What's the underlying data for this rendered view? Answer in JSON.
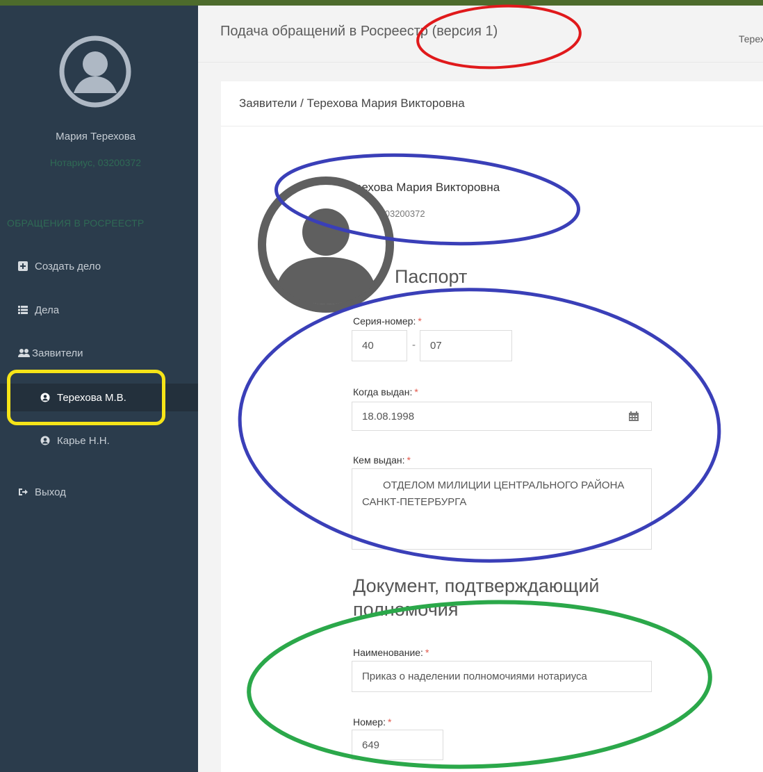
{
  "header": {
    "app_title": "Подача обращений в Росреестр (версия 1)",
    "user_short": "Терех"
  },
  "sidebar": {
    "user_name": "Мария Терехова",
    "user_role": "Нотариус, 03200372",
    "section_title": "ОБРАЩЕНИЯ В РОСРЕЕСТР",
    "items": [
      {
        "label": "Создать дело",
        "icon": "plus-square-icon"
      },
      {
        "label": "Дела",
        "icon": "list-icon"
      },
      {
        "label": "Заявители",
        "icon": "users-icon"
      },
      {
        "label": "Терехова М.В.",
        "icon": "user-circle-icon",
        "active": true
      },
      {
        "label": "Карье Н.Н.",
        "icon": "user-circle-icon"
      },
      {
        "label": "Выход",
        "icon": "sign-out-icon"
      }
    ]
  },
  "main": {
    "breadcrumb": "Заявители / Терехова Мария Викторовна",
    "profile": {
      "name": "Терехова Мария Викторовна",
      "role": "нотариус, 03200372"
    },
    "passport": {
      "heading": "Паспорт",
      "series_label": "Серия-номер:",
      "series_value": "40",
      "number_value": "07",
      "issued_date_label": "Когда выдан:",
      "issued_date_value": "18.08.1998",
      "issued_by_label": "Кем выдан:",
      "issued_by_value": "ОТДЕЛОМ МИЛИЦИИ ЦЕНТРАЛЬНОГО РАЙОНА САНКТ-ПЕТЕРБУРГА"
    },
    "authority_doc": {
      "heading": "Документ, подтверждающий полномочия",
      "name_label": "Наименование:",
      "name_value": "Приказ о наделении полномочиями нотариуса",
      "number_label": "Номер:",
      "number_value": "649"
    },
    "required_mark": "*"
  },
  "colors": {
    "sidebar_bg": "#2b3c4c",
    "accent_green": "#2f6a55",
    "required_red": "#e2594c",
    "annotation_red": "#e0191b",
    "annotation_blue": "#3a3fb8",
    "annotation_green": "#2ba84a",
    "annotation_yellow": "#f6e418"
  }
}
